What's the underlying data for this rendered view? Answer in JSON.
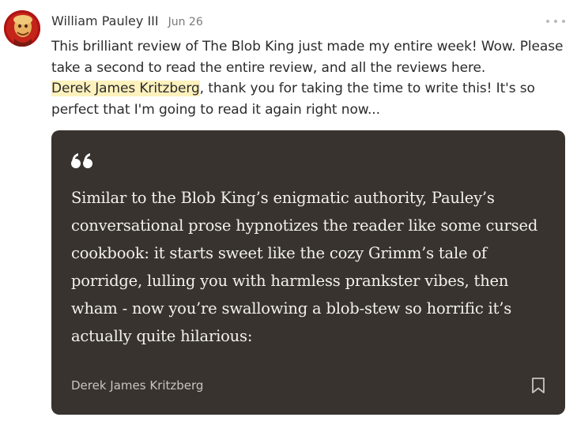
{
  "post": {
    "author": "William Pauley III",
    "date": "Jun 26",
    "more_icon": "ellipsis-icon",
    "body_line1": "This brilliant review of The Blob King just made my entire week! Wow. Please take a second to read the entire review, and all the reviews here.",
    "mention": "Derek James Kritzberg",
    "body_line2": ", thank you for taking the time to write this! It's so perfect that I'm going to read it again right now..."
  },
  "quote_card": {
    "icon": "quotation-mark-icon",
    "text": "Similar to the Blob King’s enigmatic authority, Pauley’s conversational prose hypnotizes the reader like some cursed cookbook: it starts sweet like the cozy Grimm’s tale of porridge, lulling you with harmless prankster vibes, then wham - now you’re swallowing a blob-stew so horrific it’s actually quite hilarious:",
    "author": "Derek James Kritzberg",
    "bookmark_icon": "bookmark-icon"
  },
  "colors": {
    "card_background": "#38332f",
    "mention_highlight": "#fdf1bd",
    "avatar_background": "#b01212"
  }
}
